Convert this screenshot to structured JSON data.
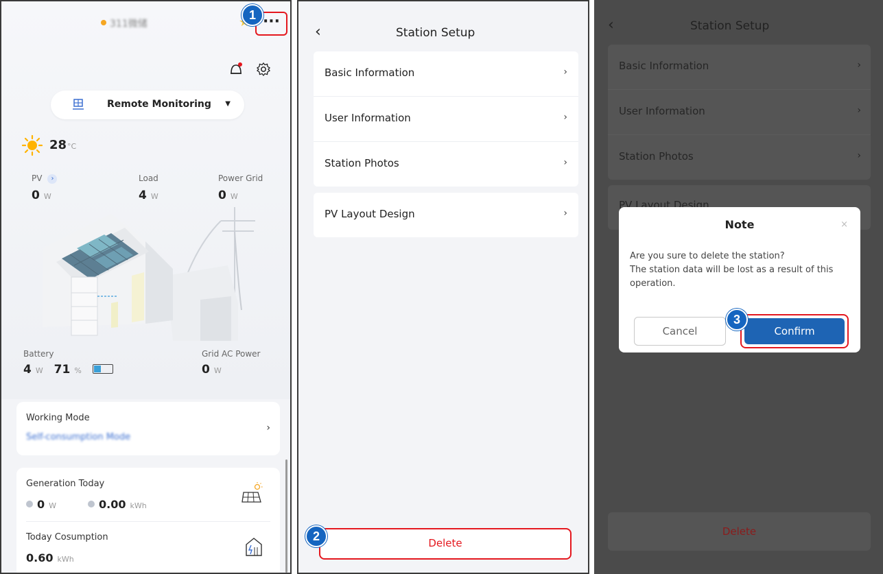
{
  "screen1": {
    "station_name": "311微储",
    "more_label": "···",
    "step1": "1",
    "mode_label": "Remote Monitoring",
    "temperature": "28",
    "temp_unit": "°C",
    "pv_label": "PV",
    "pv_value": "0",
    "pv_unit": "W",
    "load_label": "Load",
    "load_value": "4",
    "load_unit": "W",
    "grid_label": "Power Grid",
    "grid_value": "0",
    "grid_unit": "W",
    "battery_label": "Battery",
    "battery_power": "4",
    "battery_power_unit": "W",
    "battery_soc": "71",
    "battery_soc_unit": "%",
    "battery_level": 0.71,
    "gridac_label": "Grid AC Power",
    "gridac_value": "0",
    "gridac_unit": "W",
    "working_mode_title": "Working Mode",
    "working_mode_value": "Self-consumption Mode",
    "generation_title": "Generation Today",
    "gen_power": "0",
    "gen_power_unit": "W",
    "gen_energy": "0.00",
    "gen_energy_unit": "kWh",
    "consumption_title": "Today Cosumption",
    "consumption_value": "0.60",
    "consumption_unit": "kWh"
  },
  "screen2": {
    "title": "Station Setup",
    "back": "‹",
    "group1": [
      {
        "label": "Basic Information"
      },
      {
        "label": "User Information"
      },
      {
        "label": "Station Photos"
      }
    ],
    "group2": [
      {
        "label": "PV Layout Design"
      }
    ],
    "chevron": "›",
    "step2": "2",
    "delete_label": "Delete"
  },
  "screen3": {
    "title": "Station Setup",
    "back": "‹",
    "items": [
      {
        "label": "Basic Information"
      },
      {
        "label": "User Information"
      },
      {
        "label": "Station Photos"
      }
    ],
    "hidden_item": "PV Layout Design",
    "delete_label": "Delete",
    "dialog": {
      "title": "Note",
      "close": "×",
      "message": "Are you sure to delete the station?\n The station data will be lost as a result of this operation.",
      "cancel": "Cancel",
      "confirm": "Confirm",
      "step3": "3"
    }
  },
  "colors": {
    "highlight": "#e4171e",
    "badge": "#1565c0",
    "confirm": "#1e64b4",
    "overlay": "#4b4b4b"
  }
}
